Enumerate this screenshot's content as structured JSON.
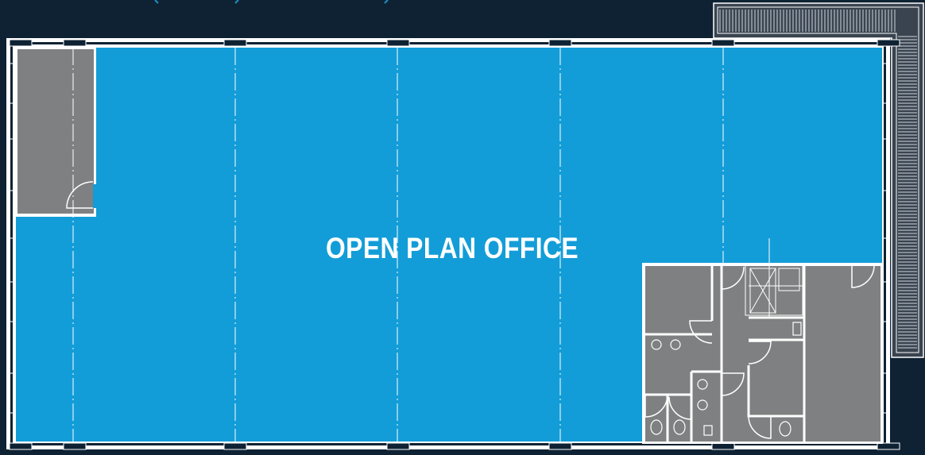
{
  "floorplan": {
    "room_label": "OPEN PLAN OFFICE",
    "colors": {
      "background": "#0e2233",
      "office_area": "#139dd8",
      "core_rooms": "#7f8081",
      "walls": "#ffffff",
      "gridlines": "#ffffff"
    },
    "icons": [
      "door-swing-icon",
      "toilet-icon",
      "washbasin-icon",
      "stair-icon",
      "lift-icon"
    ]
  }
}
